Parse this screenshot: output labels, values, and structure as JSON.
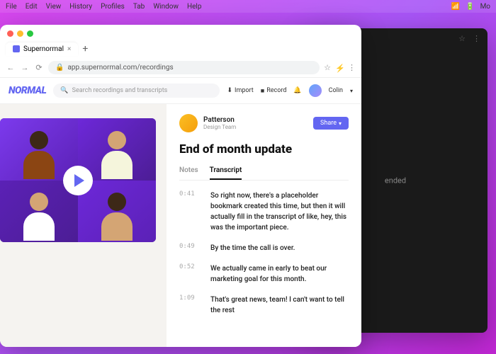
{
  "menubar": {
    "items": [
      "File",
      "Edit",
      "View",
      "History",
      "Profiles",
      "Tab",
      "Window",
      "Help"
    ],
    "right": "Mo"
  },
  "dark_window": {
    "text": "ended"
  },
  "browser": {
    "tab": {
      "title": "Supernormal",
      "close": "×"
    },
    "url": "app.supernormal.com/recordings"
  },
  "app": {
    "logo": "NORMAL",
    "search_placeholder": "Search recordings and transcripts",
    "actions": {
      "import": "Import",
      "record": "Record",
      "user": "Colin"
    }
  },
  "detail": {
    "author": {
      "name": "Patterson",
      "role": "Design Team"
    },
    "share": "Share",
    "title": "End of month update",
    "tabs": [
      "Notes",
      "Transcript"
    ],
    "active_tab": 1,
    "transcript": [
      {
        "time": "0:41",
        "text": "So right now, there's a placeholder bookmark created this time, but then it will actually fill in the transcript of like, hey, this was the important piece."
      },
      {
        "time": "0:49",
        "text": "By the time the call is over."
      },
      {
        "time": "0:52",
        "text": "We actually came in early to beat our marketing goal for this month."
      },
      {
        "time": "1:09",
        "text": "That's great news, team! I can't want to tell the rest"
      }
    ]
  }
}
